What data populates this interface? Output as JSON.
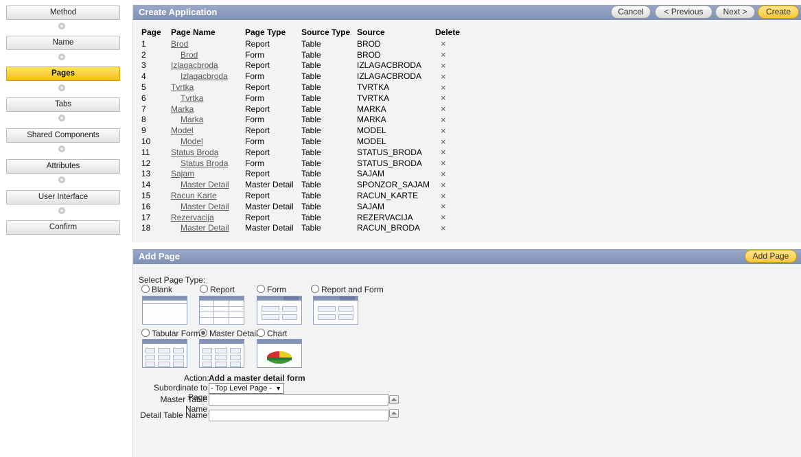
{
  "wizard": {
    "steps": [
      {
        "label": "Method"
      },
      {
        "label": "Name"
      },
      {
        "label": "Pages"
      },
      {
        "label": "Tabs"
      },
      {
        "label": "Shared Components"
      },
      {
        "label": "Attributes"
      },
      {
        "label": "User Interface"
      },
      {
        "label": "Confirm"
      }
    ],
    "current_step": "Pages"
  },
  "create_region": {
    "title": "Create Application",
    "buttons": {
      "cancel": "Cancel",
      "previous": "< Previous",
      "next": "Next >",
      "create": "Create"
    },
    "columns": [
      "Page",
      "Page Name",
      "Page Type",
      "Source Type",
      "Source",
      "Delete"
    ],
    "rows": [
      {
        "page": "1",
        "name": "Brod",
        "type": "Report",
        "source_type": "Table",
        "source": "BROD",
        "sub": false
      },
      {
        "page": "2",
        "name": "Brod",
        "type": "Form",
        "source_type": "Table",
        "source": "BROD",
        "sub": true
      },
      {
        "page": "3",
        "name": "Izlagacbroda",
        "type": "Report",
        "source_type": "Table",
        "source": "IZLAGACBRODA",
        "sub": false
      },
      {
        "page": "4",
        "name": "Izlagacbroda",
        "type": "Form",
        "source_type": "Table",
        "source": "IZLAGACBRODA",
        "sub": true
      },
      {
        "page": "5",
        "name": "Tvrtka",
        "type": "Report",
        "source_type": "Table",
        "source": "TVRTKA",
        "sub": false
      },
      {
        "page": "6",
        "name": "Tvrtka",
        "type": "Form",
        "source_type": "Table",
        "source": "TVRTKA",
        "sub": true
      },
      {
        "page": "7",
        "name": "Marka",
        "type": "Report",
        "source_type": "Table",
        "source": "MARKA",
        "sub": false
      },
      {
        "page": "8",
        "name": "Marka",
        "type": "Form",
        "source_type": "Table",
        "source": "MARKA",
        "sub": true
      },
      {
        "page": "9",
        "name": "Model",
        "type": "Report",
        "source_type": "Table",
        "source": "MODEL",
        "sub": false
      },
      {
        "page": "10",
        "name": "Model",
        "type": "Form",
        "source_type": "Table",
        "source": "MODEL",
        "sub": true
      },
      {
        "page": "11",
        "name": "Status Broda",
        "type": "Report",
        "source_type": "Table",
        "source": "STATUS_BRODA",
        "sub": false
      },
      {
        "page": "12",
        "name": "Status Broda",
        "type": "Form",
        "source_type": "Table",
        "source": "STATUS_BRODA",
        "sub": true
      },
      {
        "page": "13",
        "name": "Sajam",
        "type": "Report",
        "source_type": "Table",
        "source": "SAJAM",
        "sub": false
      },
      {
        "page": "14",
        "name": "Master Detail",
        "type": "Master Detail",
        "source_type": "Table",
        "source": "SPONZOR_SAJAM",
        "sub": true
      },
      {
        "page": "15",
        "name": "Racun Karte",
        "type": "Report",
        "source_type": "Table",
        "source": "RACUN_KARTE",
        "sub": false
      },
      {
        "page": "16",
        "name": "Master Detail",
        "type": "Master Detail",
        "source_type": "Table",
        "source": "SAJAM",
        "sub": true
      },
      {
        "page": "17",
        "name": "Rezervacija",
        "type": "Report",
        "source_type": "Table",
        "source": "REZERVACIJA",
        "sub": false
      },
      {
        "page": "18",
        "name": "Master Detail",
        "type": "Master Detail",
        "source_type": "Table",
        "source": "RACUN_BRODA",
        "sub": true
      }
    ],
    "delete_glyph": "×"
  },
  "add_region": {
    "title": "Add Page",
    "add_button": "Add Page",
    "select_label": "Select Page Type:",
    "page_types": [
      {
        "label": "Blank",
        "selected": false
      },
      {
        "label": "Report",
        "selected": false
      },
      {
        "label": "Form",
        "selected": false
      },
      {
        "label": "Report and Form",
        "selected": false
      },
      {
        "label": "Tabular Form",
        "selected": false
      },
      {
        "label": "Master Detail",
        "selected": true
      },
      {
        "label": "Chart",
        "selected": false
      }
    ],
    "action_label": "Action:",
    "action_value": "Add a master detail form",
    "subordinate_label": "Subordinate to Page",
    "subordinate_value": "- Top Level Page -",
    "master_label": "Master Table Name",
    "master_value": "",
    "detail_label": "Detail Table Name",
    "detail_value": ""
  }
}
